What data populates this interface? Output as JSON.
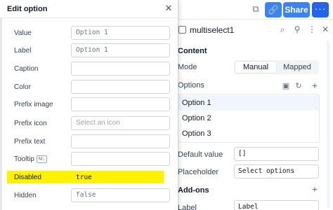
{
  "topbar": {
    "share_label": "Share",
    "preview_icon": "preview-icon",
    "link_icon": "link-icon",
    "more_icon": "more-icon"
  },
  "inspector": {
    "component_name": "multiselect1",
    "content_title": "Content",
    "mode_label": "Mode",
    "mode_options": [
      "Manual",
      "Mapped"
    ],
    "mode_selected": "Manual",
    "options_label": "Options",
    "options": [
      "Option 1",
      "Option 2",
      "Option 3"
    ],
    "default_value_label": "Default value",
    "default_value": "[]",
    "placeholder_label": "Placeholder",
    "placeholder_value": "Select options",
    "addons_title": "Add-ons",
    "label_row_label": "Label",
    "label_row_value": "Label"
  },
  "modal": {
    "title": "Edit option",
    "fields": {
      "value": {
        "label": "Value",
        "value": "Option 1"
      },
      "label": {
        "label": "Label",
        "value": "Option 1"
      },
      "caption": {
        "label": "Caption",
        "value": ""
      },
      "color": {
        "label": "Color",
        "value": ""
      },
      "prefix_image": {
        "label": "Prefix image",
        "value": ""
      },
      "prefix_icon": {
        "label": "Prefix icon",
        "placeholder": "Select an icon"
      },
      "prefix_text": {
        "label": "Prefix text",
        "value": ""
      },
      "tooltip": {
        "label": "Tooltip",
        "badge": "M↓",
        "value": ""
      },
      "disabled": {
        "label": "Disabled",
        "value": "true"
      },
      "hidden": {
        "label": "Hidden",
        "value": "false"
      }
    }
  },
  "colors": {
    "accent": "#3b82f6",
    "highlight": "#fff200"
  }
}
